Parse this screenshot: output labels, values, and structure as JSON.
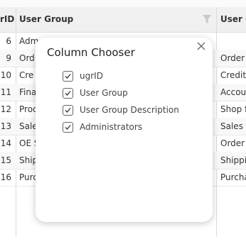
{
  "grid": {
    "columns": [
      "rID",
      "User Group",
      "User G"
    ],
    "rows": [
      {
        "id": "6",
        "group": "Adm",
        "desc": ""
      },
      {
        "id": "9",
        "group": "Ord",
        "desc": "Order I"
      },
      {
        "id": "10",
        "group": "Cre",
        "desc": "Credit"
      },
      {
        "id": "11",
        "group": "Fina",
        "desc": "Accou"
      },
      {
        "id": "12",
        "group": "Prod",
        "desc": "Shop f"
      },
      {
        "id": "13",
        "group": "Sale",
        "desc": "Sales U"
      },
      {
        "id": "14",
        "group": "OE S",
        "desc": "Order I"
      },
      {
        "id": "15",
        "group": "Ship",
        "desc": "Shippin"
      },
      {
        "id": "16",
        "group": "Purchasing",
        "desc": "Purcha"
      }
    ]
  },
  "column_chooser": {
    "title": "Column Chooser",
    "options": [
      {
        "label": "ugrID",
        "checked": true
      },
      {
        "label": "User Group",
        "checked": true
      },
      {
        "label": "User Group Description",
        "checked": true
      },
      {
        "label": "Administrators",
        "checked": true
      }
    ]
  },
  "icons": {
    "filter": "filter-icon",
    "close": "close-icon",
    "check": "check-icon"
  },
  "colors": {
    "header_bg": "#f0f0f0",
    "row_alt_bg": "#f8f8f8",
    "border": "#dcdcdc"
  }
}
